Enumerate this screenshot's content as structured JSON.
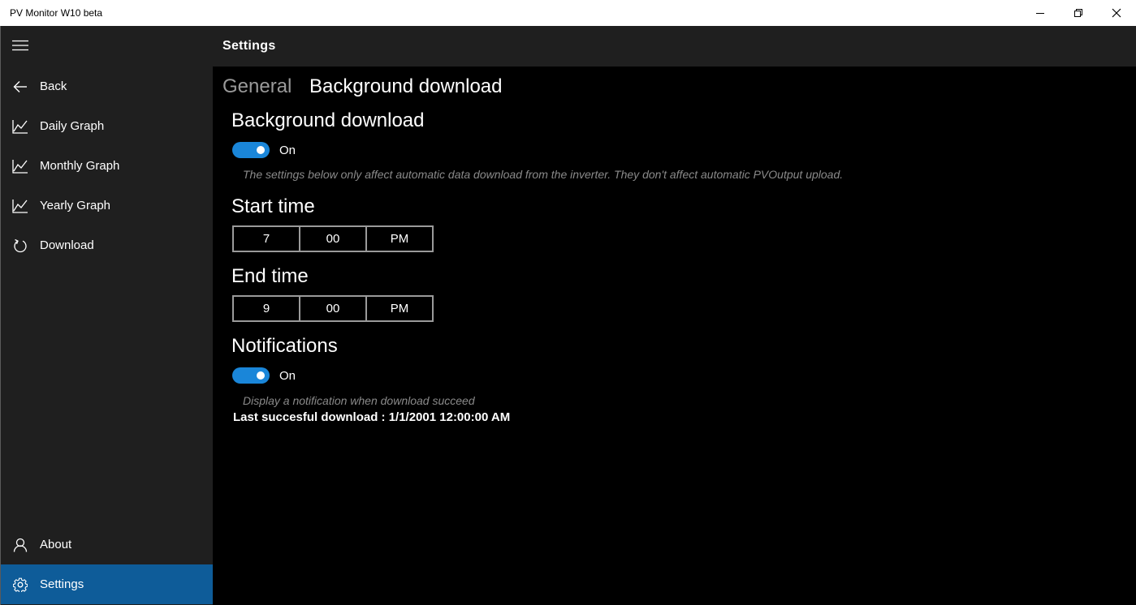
{
  "window": {
    "title": "PV Monitor W10 beta"
  },
  "sidebar": {
    "items": [
      {
        "label": "Back",
        "icon": "back-arrow-icon"
      },
      {
        "label": "Daily Graph",
        "icon": "line-chart-icon"
      },
      {
        "label": "Monthly Graph",
        "icon": "line-chart-icon"
      },
      {
        "label": "Yearly Graph",
        "icon": "line-chart-icon"
      },
      {
        "label": "Download",
        "icon": "refresh-icon"
      }
    ],
    "bottom_items": [
      {
        "label": "About",
        "icon": "person-icon"
      },
      {
        "label": "Settings",
        "icon": "gear-icon",
        "selected": true
      }
    ]
  },
  "header": {
    "title": "Settings"
  },
  "tabs": [
    {
      "label": "General",
      "active": false
    },
    {
      "label": "Background download",
      "active": true
    }
  ],
  "background_download": {
    "title": "Background download",
    "toggle_state": "On",
    "hint": "The settings below only affect automatic data download from the inverter. They don't affect automatic PVOutput upload."
  },
  "start_time": {
    "title": "Start time",
    "hour": "7",
    "minute": "00",
    "period": "PM"
  },
  "end_time": {
    "title": "End time",
    "hour": "9",
    "minute": "00",
    "period": "PM"
  },
  "notifications": {
    "title": "Notifications",
    "toggle_state": "On",
    "hint": "Display a notification when download succeed"
  },
  "last_download": "Last succesful download : 1/1/2001 12:00:00 AM",
  "colors": {
    "accent": "#1a86d9",
    "selected_nav": "#0e5c99",
    "sidebar_bg": "#1f1f1f",
    "content_bg": "#000000"
  }
}
